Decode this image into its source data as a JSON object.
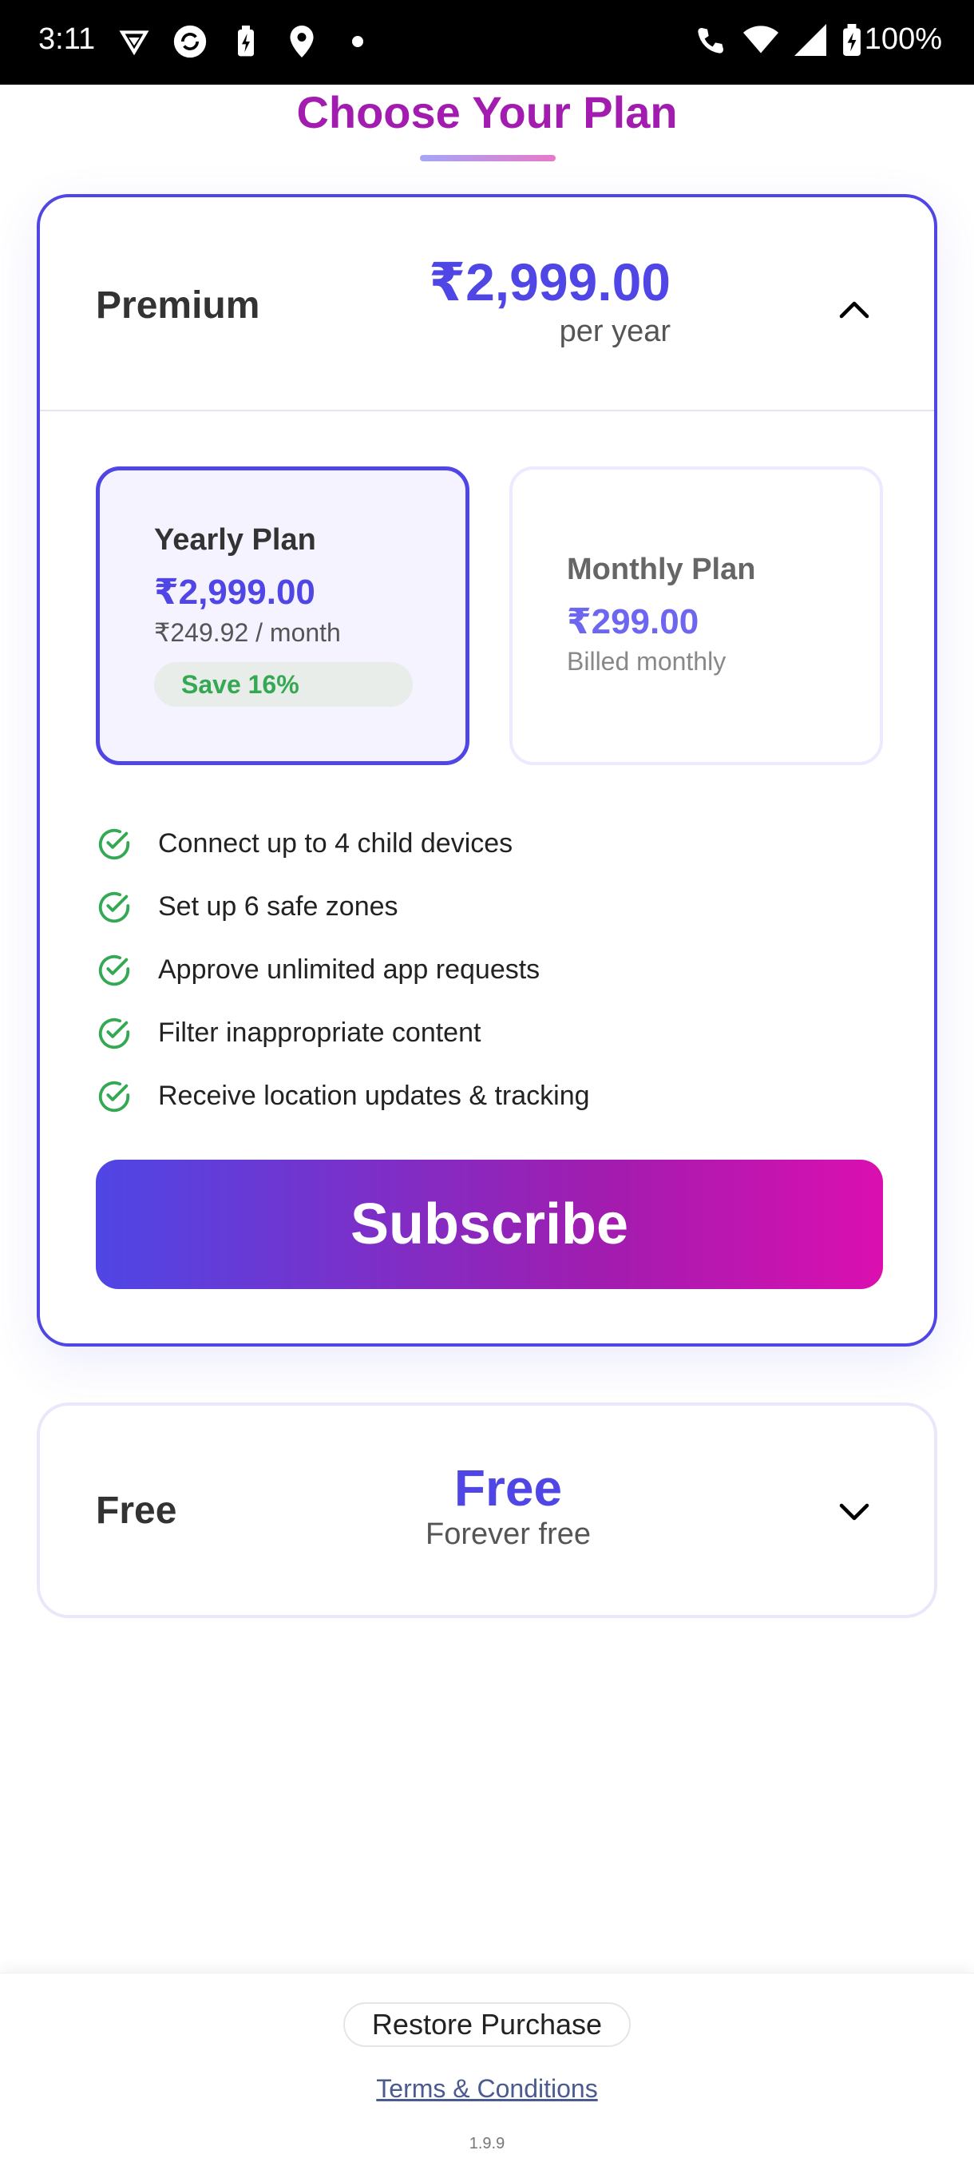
{
  "status_bar": {
    "time": "3:11",
    "battery": "100%",
    "left_icons": [
      "vpn-icon",
      "sync-icon",
      "battery-saver-icon",
      "location-icon",
      "dot-icon"
    ],
    "right_icons": [
      "wifi-calling-icon",
      "wifi-icon",
      "signal-icon",
      "battery-icon"
    ]
  },
  "header": {
    "title": "Choose Your Plan",
    "title_color": "#a21caf"
  },
  "premium": {
    "name": "Premium",
    "price": "₹2,999.00",
    "period": "per year",
    "expanded": true,
    "options": {
      "yearly": {
        "title": "Yearly Plan",
        "price": "₹2,999.00",
        "sub": "₹249.92 / month",
        "badge": "Save 16%",
        "selected": true
      },
      "monthly": {
        "title": "Monthly Plan",
        "price": "₹299.00",
        "sub": "Billed monthly",
        "selected": false
      }
    },
    "features": [
      "Connect up to 4 child devices",
      "Set up 6 safe zones",
      "Approve unlimited app requests",
      "Filter inappropriate content",
      "Receive location updates & tracking"
    ],
    "subscribe_label": "Subscribe"
  },
  "free": {
    "name": "Free",
    "price": "Free",
    "period": "Forever free",
    "expanded": false
  },
  "footer": {
    "restore_label": "Restore Purchase",
    "terms_label": "Terms & Conditions",
    "version": "1.9.9"
  },
  "colors": {
    "accent": "#4f46e5",
    "magenta": "#db0fb0",
    "success": "#34a853"
  }
}
